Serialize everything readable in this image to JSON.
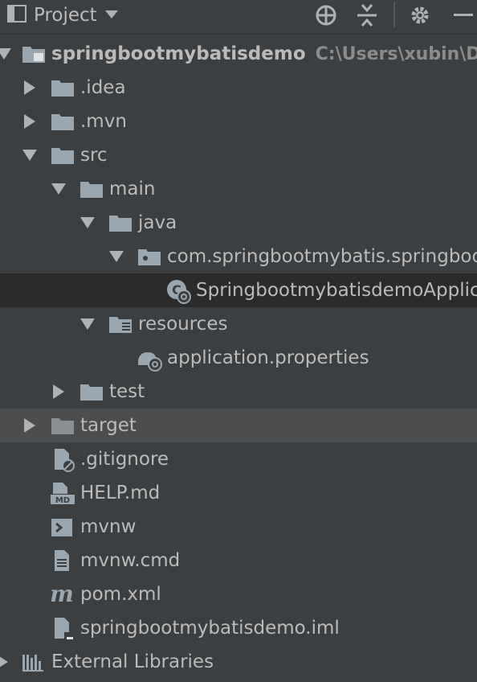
{
  "toolbar": {
    "title": "Project",
    "icons": [
      "locate-icon",
      "collapse-all-icon",
      "settings-icon",
      "minimize-icon"
    ]
  },
  "tree": {
    "root_label": "springbootmybatisdemo",
    "root_path": "C:\\Users\\xubin\\Des",
    "items": [
      {
        "label": ".idea"
      },
      {
        "label": ".mvn"
      },
      {
        "label": "src"
      },
      {
        "label": "main"
      },
      {
        "label": "java"
      },
      {
        "label": "com.springbootmybatis.springboo"
      },
      {
        "label": "SpringbootmybatisdemoApplic"
      },
      {
        "label": "resources"
      },
      {
        "label": "application.properties"
      },
      {
        "label": "test"
      },
      {
        "label": "target"
      },
      {
        "label": ".gitignore"
      },
      {
        "label": "HELP.md"
      },
      {
        "label": "mvnw"
      },
      {
        "label": "mvnw.cmd"
      },
      {
        "label": "pom.xml"
      },
      {
        "label": "springbootmybatisdemo.iml"
      },
      {
        "label": "External Libraries"
      }
    ]
  },
  "colors": {
    "background": "#3c3f41",
    "selected_row": "#2b2b2b",
    "hover_row": "#4b4d4f",
    "text": "#bbbbbb",
    "folder_icon": "#9aa7b0"
  }
}
